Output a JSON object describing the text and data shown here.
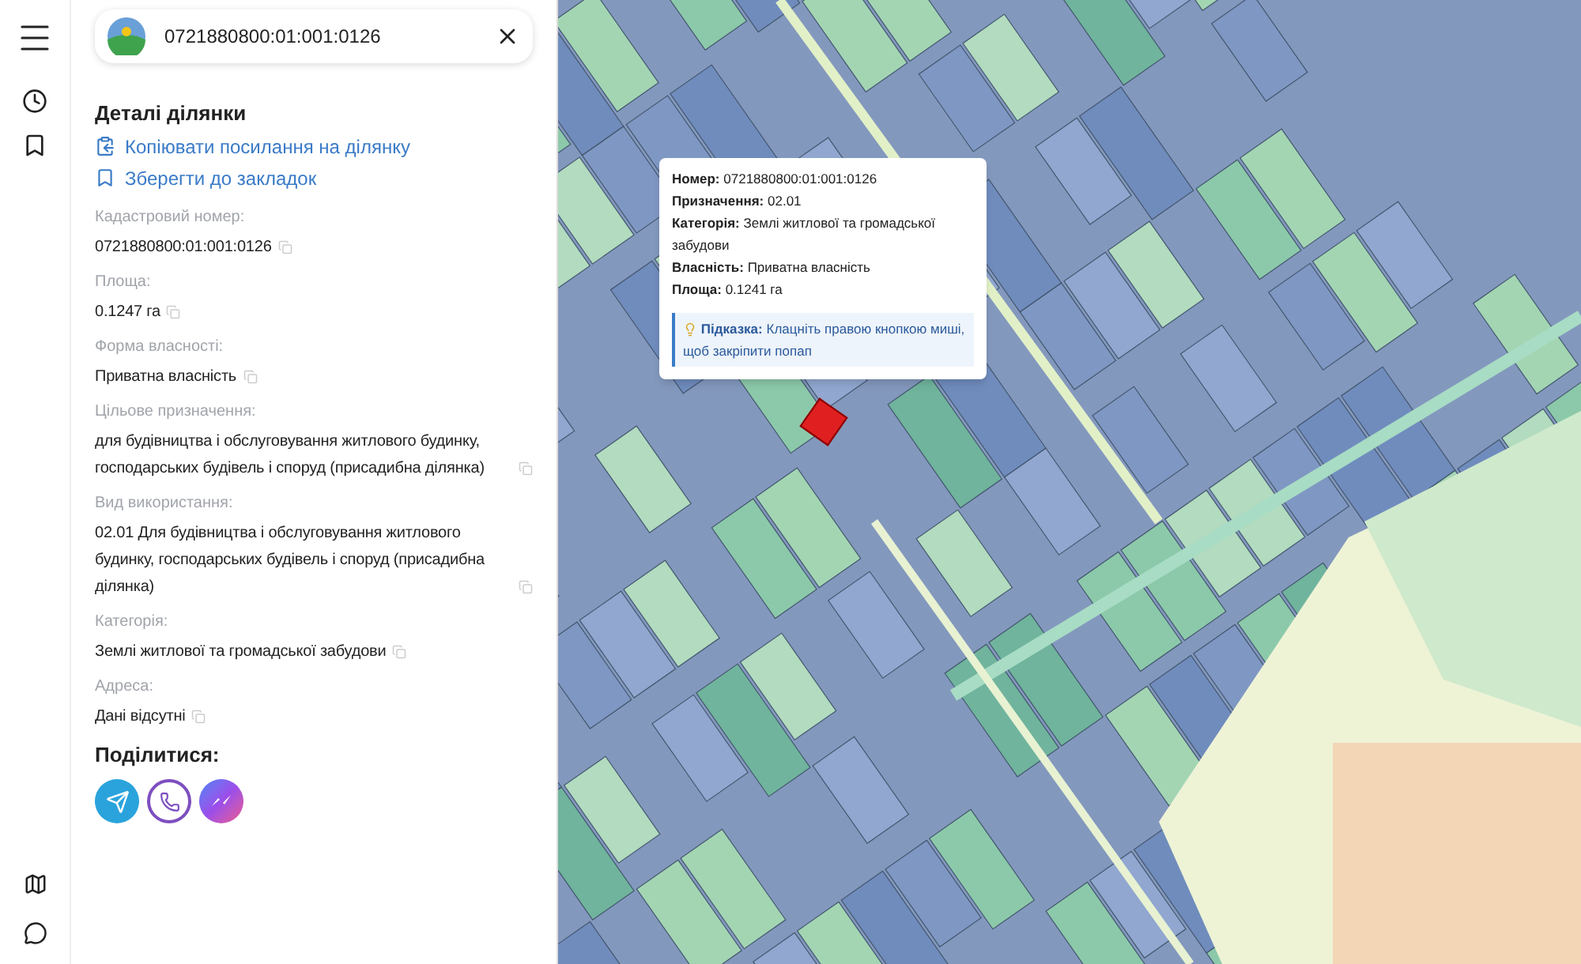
{
  "search": {
    "value": "0721880800:01:001:0126"
  },
  "details": {
    "title": "Деталі ділянки",
    "actions": [
      {
        "kind": "copy",
        "label": "Копіювати посилання на ділянку"
      },
      {
        "kind": "bookmark",
        "label": "Зберегти до закладок"
      }
    ]
  },
  "fields": [
    {
      "label": "Кадастровий номер:",
      "value": "0721880800:01:001:0126"
    },
    {
      "label": "Площа:",
      "value": "0.1247 га"
    },
    {
      "label": "Форма власності:",
      "value": "Приватна власність"
    },
    {
      "label": "Цільове призначення:",
      "value": "для будівництва і обслуговування житлового будинку, господарських будівель і споруд (присадибна ділянка)"
    },
    {
      "label": "Вид використання:",
      "value": "02.01 Для будівництва і обслуговування житлового будинку, господарських будівель і споруд (присадибна ділянка)"
    },
    {
      "label": "Категорія:",
      "value": "Землі житлової та громадської забудови"
    },
    {
      "label": "Адреса:",
      "value": "Дані відсутні"
    }
  ],
  "share": {
    "title": "Поділитися:",
    "buttons": [
      {
        "kind": "telegram"
      },
      {
        "kind": "viber"
      },
      {
        "kind": "messenger"
      }
    ]
  },
  "popup": {
    "rows": [
      {
        "label": "Номер:",
        "value": "0721880800:01:001:0126"
      },
      {
        "label": "Призначення:",
        "value": "02.01"
      },
      {
        "label": "Категорія:",
        "value": "Землі житлової та громадської забудови"
      },
      {
        "label": "Власність:",
        "value": "Приватна власність"
      },
      {
        "label": "Площа:",
        "value": "0.1241 га"
      }
    ],
    "hint": {
      "label": "Підказка:",
      "text": "Клацніть правою кнопкою миші, щоб закріпити попап"
    }
  }
}
